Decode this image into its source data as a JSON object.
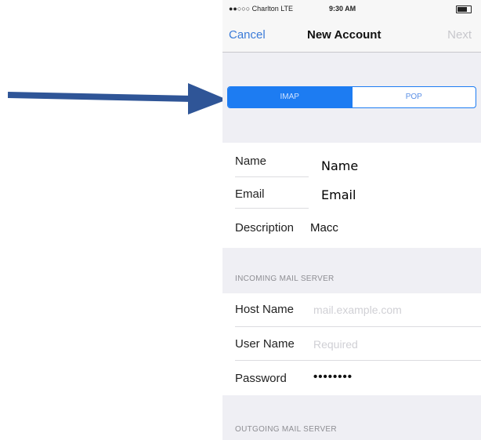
{
  "status_bar": {
    "carrier": "●●○○○ Charlton  LTE",
    "time": "9:30 AM"
  },
  "nav": {
    "cancel": "Cancel",
    "title": "New Account",
    "next": "Next"
  },
  "segment": {
    "options": [
      "IMAP",
      "POP"
    ],
    "selected": "IMAP"
  },
  "account": {
    "name_label": "Name",
    "name_value": "Name",
    "email_label": "Email",
    "email_value": "Email",
    "description_label": "Description",
    "description_value": "Macc"
  },
  "incoming": {
    "header": "INCOMING MAIL SERVER",
    "host_label": "Host Name",
    "host_placeholder": "mail.example.com",
    "user_label": "User Name",
    "user_placeholder": "Required",
    "password_label": "Password",
    "password_value": "••••••••"
  },
  "outgoing": {
    "header": "OUTGOING MAIL SERVER"
  },
  "colors": {
    "accent": "#1d7cf2",
    "annotation_arrow": "#2f5597"
  },
  "icons": {
    "annotation": "arrow-right-icon",
    "battery": "battery-icon"
  }
}
